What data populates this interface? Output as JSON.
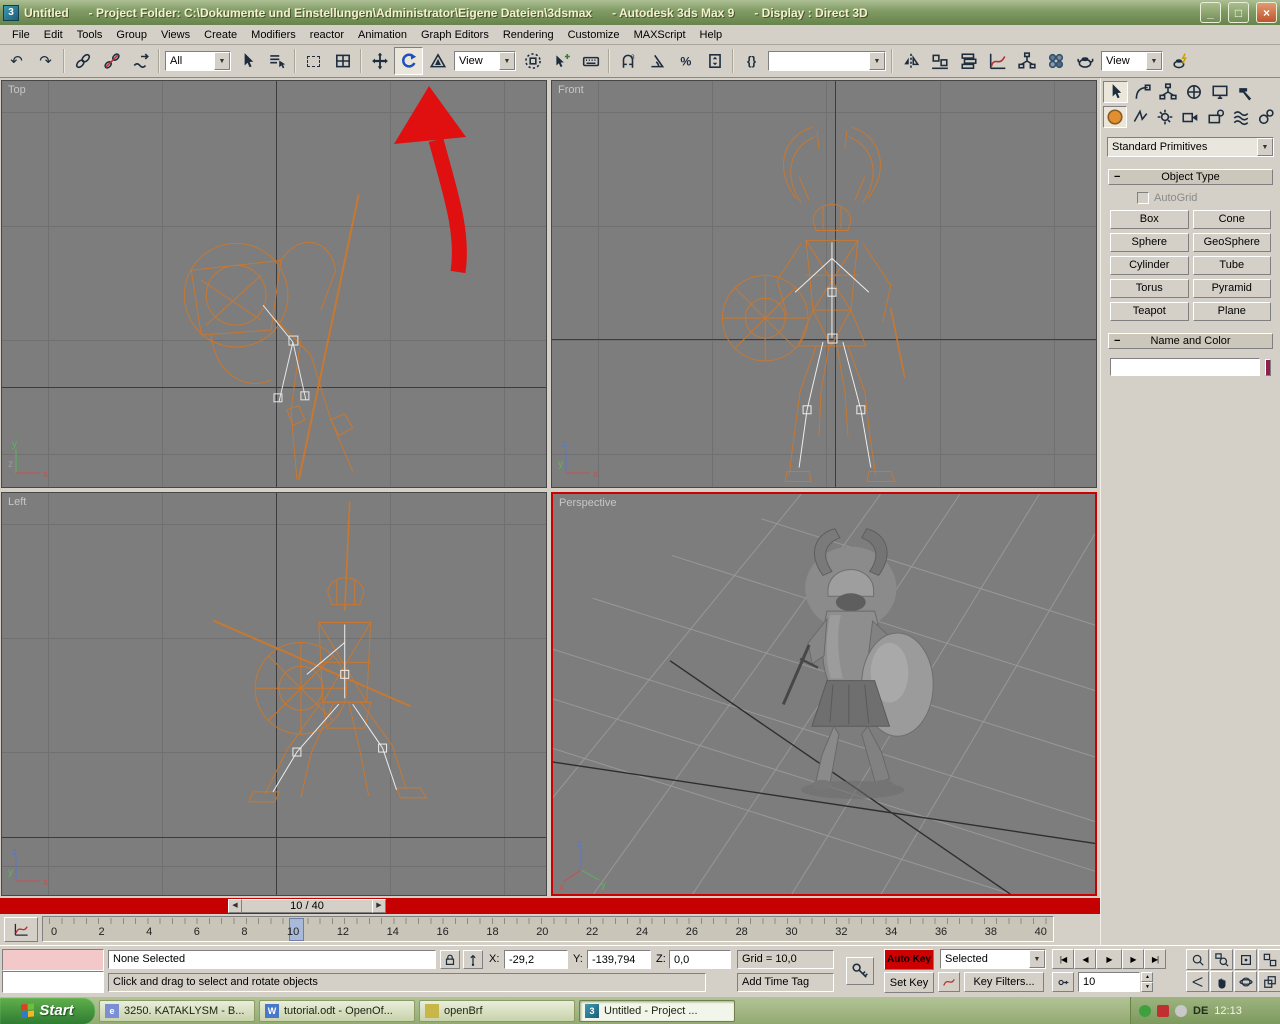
{
  "window": {
    "title": "Untitled      - Project Folder: C:\\Dokumente und Einstellungen\\Administrator\\Eigene Dateien\\3dsmax      - Autodesk 3ds Max 9      - Display : Direct 3D"
  },
  "icons": {
    "undo": "↶",
    "redo": "↷",
    "minimize": "_",
    "maximize": "□",
    "close": "×",
    "arrow_down": "▼",
    "arrow_up": "▲",
    "braces": "{}",
    "goto_start": "|◀",
    "prev_frame": "◀",
    "play": "▶",
    "next_frame": "▶",
    "goto_end": "▶|",
    "slider_left": "◀",
    "slider_right": "▶"
  },
  "menu_items": [
    "File",
    "Edit",
    "Tools",
    "Group",
    "Views",
    "Create",
    "Modifiers",
    "reactor",
    "Animation",
    "Graph Editors",
    "Rendering",
    "Customize",
    "MAXScript",
    "Help"
  ],
  "toolbar": {
    "selection_filter": "All",
    "ref_coord": "View",
    "named_sets": "",
    "render_type": "View"
  },
  "viewports": {
    "top": "Top",
    "front": "Front",
    "left": "Left",
    "perspective": "Perspective"
  },
  "command_panel": {
    "category": "Standard Primitives",
    "object_type_title": "Object Type",
    "autogrid_label": "AutoGrid",
    "primitive_buttons": [
      "Box",
      "Cone",
      "Sphere",
      "GeoSphere",
      "Cylinder",
      "Tube",
      "Torus",
      "Pyramid",
      "Teapot",
      "Plane"
    ],
    "name_color_title": "Name and Color",
    "object_name": "",
    "object_color": "#8C2050"
  },
  "timeline": {
    "slider_text": "10 / 40",
    "tick_labels": [
      "0",
      "2",
      "4",
      "6",
      "8",
      "10",
      "12",
      "14",
      "16",
      "18",
      "20",
      "22",
      "24",
      "26",
      "28",
      "30",
      "32",
      "34",
      "36",
      "38",
      "40"
    ],
    "current_frame": "10",
    "total_frames": "40"
  },
  "status": {
    "selection": "None Selected",
    "prompt": "Click and drag to select and rotate objects",
    "x_label": "X:",
    "x_value": "-29,2",
    "y_label": "Y:",
    "y_value": "-139,794",
    "z_label": "Z:",
    "z_value": "0,0",
    "grid": "Grid = 10,0",
    "add_time_tag": "Add Time Tag",
    "auto_key": "Auto Key",
    "set_key": "Set Key",
    "key_mode": "Selected",
    "key_filters": "Key Filters...",
    "frame": "10"
  },
  "taskbar": {
    "start": "Start",
    "tasks": [
      "3250. KATAKLYSM - B...",
      "tutorial.odt - OpenOf...",
      "openBrf",
      "Untitled      - Project ..."
    ],
    "lang": "DE",
    "clock": "12:13"
  },
  "colors": {
    "autokey_active": "#CC0000",
    "active_viewport_border": "#CC0000",
    "time_slider_bar": "#C40000",
    "wireframe_orange": "#C87830",
    "viewport_bg": "#7D7D7D",
    "taskbar_green": "#9DB37E"
  }
}
